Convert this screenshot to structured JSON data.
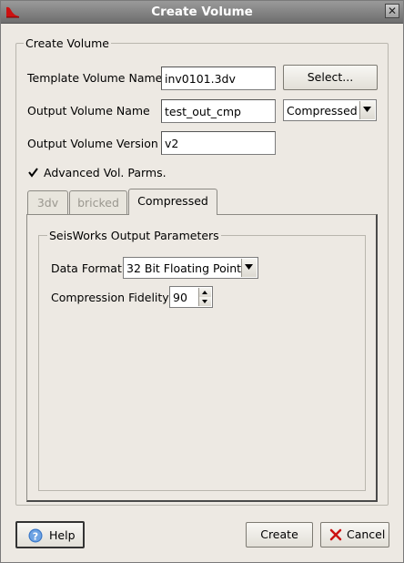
{
  "window": {
    "title": "Create Volume",
    "close_glyph": "✕",
    "icon": "app-logo-icon"
  },
  "group": {
    "legend": "Create Volume"
  },
  "template": {
    "label": "Template Volume Name",
    "value": "inv0101.3dv",
    "select_button": "Select..."
  },
  "output": {
    "label": "Output Volume Name",
    "value": "test_out_cmp",
    "format_select": "Compressed"
  },
  "version": {
    "label": "Output Volume Version",
    "value": "v2"
  },
  "advanced": {
    "label": "Advanced Vol. Parms.",
    "checked": true
  },
  "tabs": [
    {
      "label": "3dv",
      "state": "disabled"
    },
    {
      "label": "bricked",
      "state": "disabled"
    },
    {
      "label": "Compressed",
      "state": "active"
    }
  ],
  "seisworks": {
    "legend": "SeisWorks Output Parameters",
    "data_format_label": "Data Format",
    "data_format_value": "32 Bit Floating Point",
    "fidelity_label": "Compression Fidelity",
    "fidelity_value": "90"
  },
  "footer": {
    "help": "Help",
    "create": "Create",
    "cancel": "Cancel"
  },
  "colors": {
    "titlebar": "#808080",
    "window_bg": "#ede9e3",
    "help_icon": "#3a78c8",
    "cancel_icon": "#cc1111"
  }
}
